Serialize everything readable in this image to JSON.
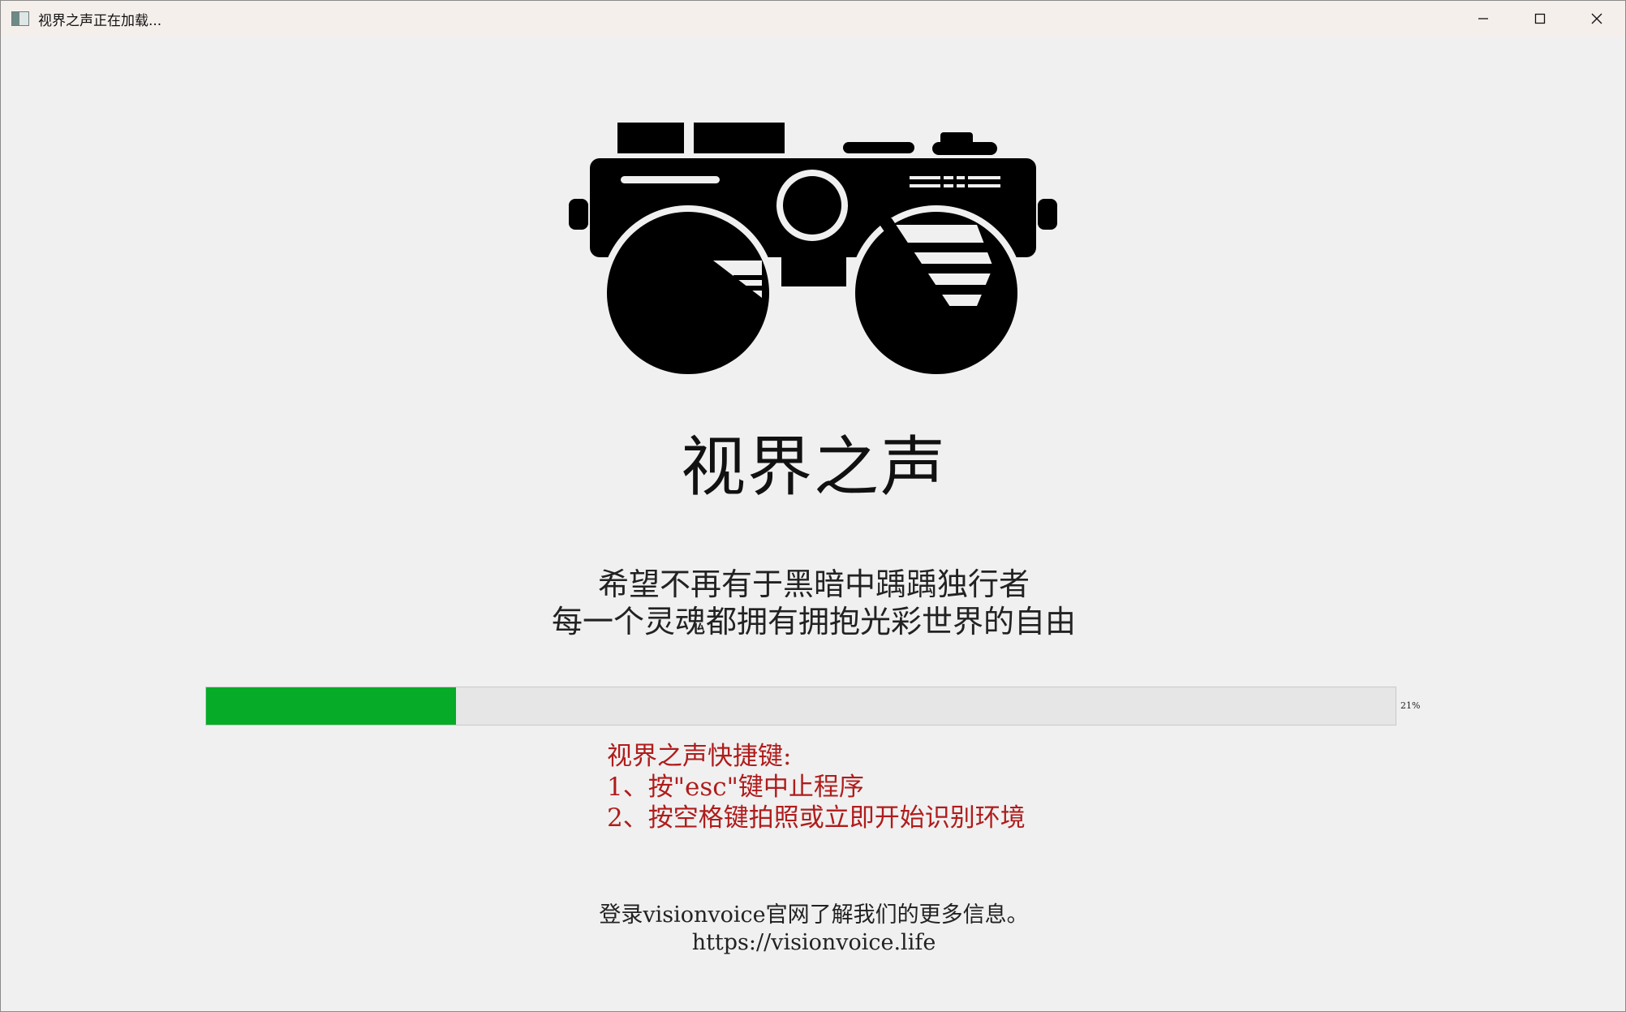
{
  "window": {
    "title": "视界之声正在加载...",
    "controls": {
      "minimize_icon": "minimize-icon",
      "maximize_icon": "maximize-icon",
      "close_icon": "close-icon"
    }
  },
  "logo": {
    "icon": "binocular-camera-logo",
    "color": "#000000"
  },
  "app_name": "视界之声",
  "slogan": {
    "line1": "希望不再有于黑暗中踽踽独行者",
    "line2": "每一个灵魂都拥有拥抱光彩世界的自由"
  },
  "progress": {
    "percent": 21,
    "label": "21%",
    "fill_color": "#06ab28"
  },
  "shortcuts": {
    "heading": "视界之声快捷键:",
    "items": [
      "1、按\"esc\"键中止程序",
      "2、按空格键拍照或立即开始识别环境"
    ],
    "color": "#b01c1c"
  },
  "footer": {
    "line1": "登录visionvoice官网了解我们的更多信息。",
    "url": "https://visionvoice.life"
  }
}
